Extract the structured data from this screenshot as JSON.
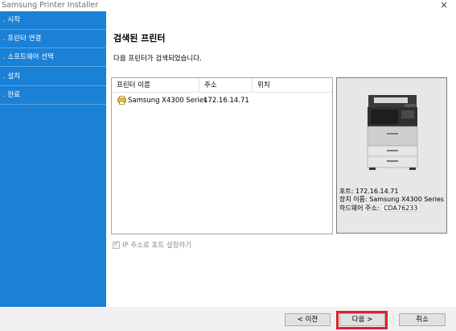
{
  "window": {
    "title": "Samsung Printer Installer",
    "close_glyph": "×"
  },
  "sidebar": {
    "items": [
      {
        "label": ". 시작"
      },
      {
        "label": ". 프린터 연결"
      },
      {
        "label": ". 소프트웨어 선택"
      },
      {
        "label": ". 설치"
      },
      {
        "label": ". 완료"
      }
    ]
  },
  "main": {
    "title": "검색된 프린터",
    "description": "다음 프린터가 검색되었습니다."
  },
  "list": {
    "columns": [
      "프린터 이름",
      "주소",
      "위치"
    ],
    "rows": [
      {
        "name": "Samsung X4300 Series",
        "address": "172.16.14.71",
        "location": ""
      }
    ]
  },
  "preview": {
    "port_label": "포트:",
    "port_value": "172.16.14.71",
    "device_label": "장치 이름:",
    "device_value": "Samsung X4300 Series",
    "hw_label": "하드웨어 주소:",
    "hw_value": "CDA76233"
  },
  "options": {
    "ip_port_label": "IP 주소로 포트 설정하기",
    "ip_port_checked": true
  },
  "buttons": {
    "back": "< 이전",
    "next": "다음 >",
    "cancel": "취소"
  },
  "colors": {
    "sidebar": "#1a81d6",
    "highlight": "#d6262d"
  }
}
